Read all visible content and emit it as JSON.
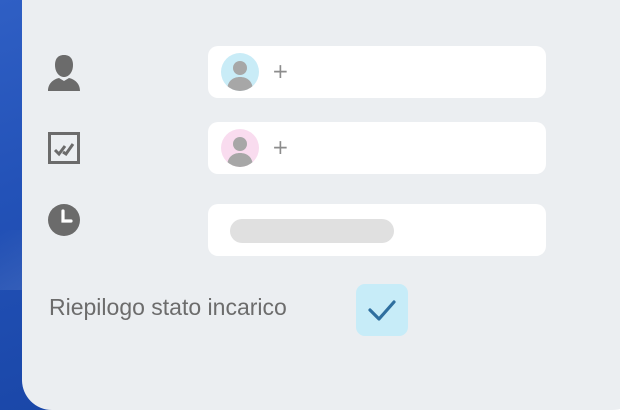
{
  "rows": [
    {
      "icon": "user-icon",
      "field": {
        "type": "assignee",
        "avatar": "person-avatar-icon",
        "avatar_color": "#c9ecf7",
        "add_label": "+"
      }
    },
    {
      "icon": "checklist-icon",
      "field": {
        "type": "reviewer",
        "avatar": "person-avatar-icon",
        "avatar_color": "#f9dcef",
        "add_label": "+"
      }
    },
    {
      "icon": "clock-icon",
      "field": {
        "type": "time",
        "placeholder_bar": true
      }
    }
  ],
  "summary": {
    "label": "Riepilogo stato incarico",
    "checked": true,
    "check_icon": "checkmark-icon"
  },
  "colors": {
    "card_bg": "#ebeef1",
    "accent_blue": "#2352b8",
    "icon_gray": "#6b6b6b",
    "check_bg": "#c7ecf8",
    "check_color": "#2f6f9f"
  }
}
